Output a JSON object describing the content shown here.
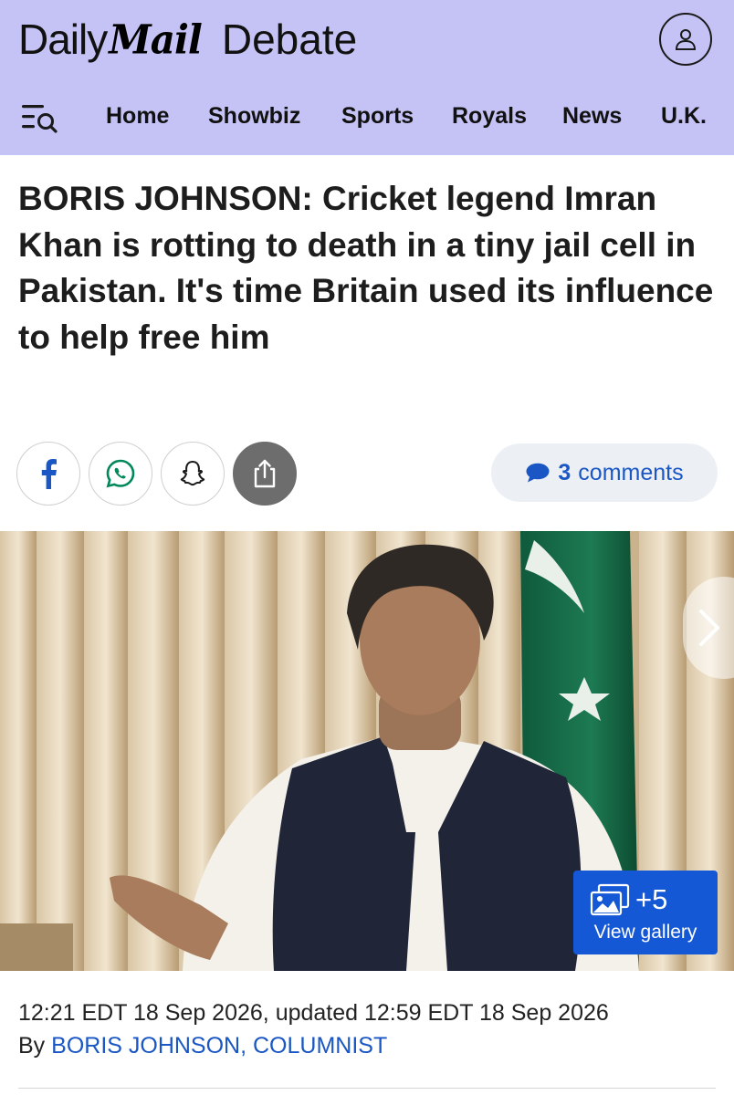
{
  "header": {
    "brand_daily": "Daily",
    "brand_mail": "Mail",
    "brand_section": "Debate",
    "background_color": "#c5c3f5",
    "profile_icon": "user-icon",
    "menu_icon": "menu-search-icon"
  },
  "nav": {
    "items": [
      {
        "label": "Home"
      },
      {
        "label": "Showbiz"
      },
      {
        "label": "Sports"
      },
      {
        "label": "Royals"
      },
      {
        "label": "News"
      },
      {
        "label": "U.K."
      }
    ]
  },
  "article": {
    "headline": "BORIS JOHNSON: Cricket legend Imran Khan is rotting to death in a tiny jail cell in Pakistan. It's time Britain used its influence to help free him",
    "timestamp": "12:21 EDT 18 Sep 2026, updated 12:59 EDT 18 Sep 2026",
    "byline_prefix": "By",
    "byline_author": "BORIS JOHNSON, COLUMNIST"
  },
  "share": {
    "buttons": [
      {
        "icon": "facebook-icon"
      },
      {
        "icon": "whatsapp-icon"
      },
      {
        "icon": "snapchat-icon"
      },
      {
        "icon": "share-icon"
      }
    ],
    "comments_count": "3",
    "comments_label": "comments",
    "accent_color": "#1a57c4"
  },
  "gallery": {
    "count": "+5",
    "label": "View gallery",
    "color": "#1558d6"
  }
}
